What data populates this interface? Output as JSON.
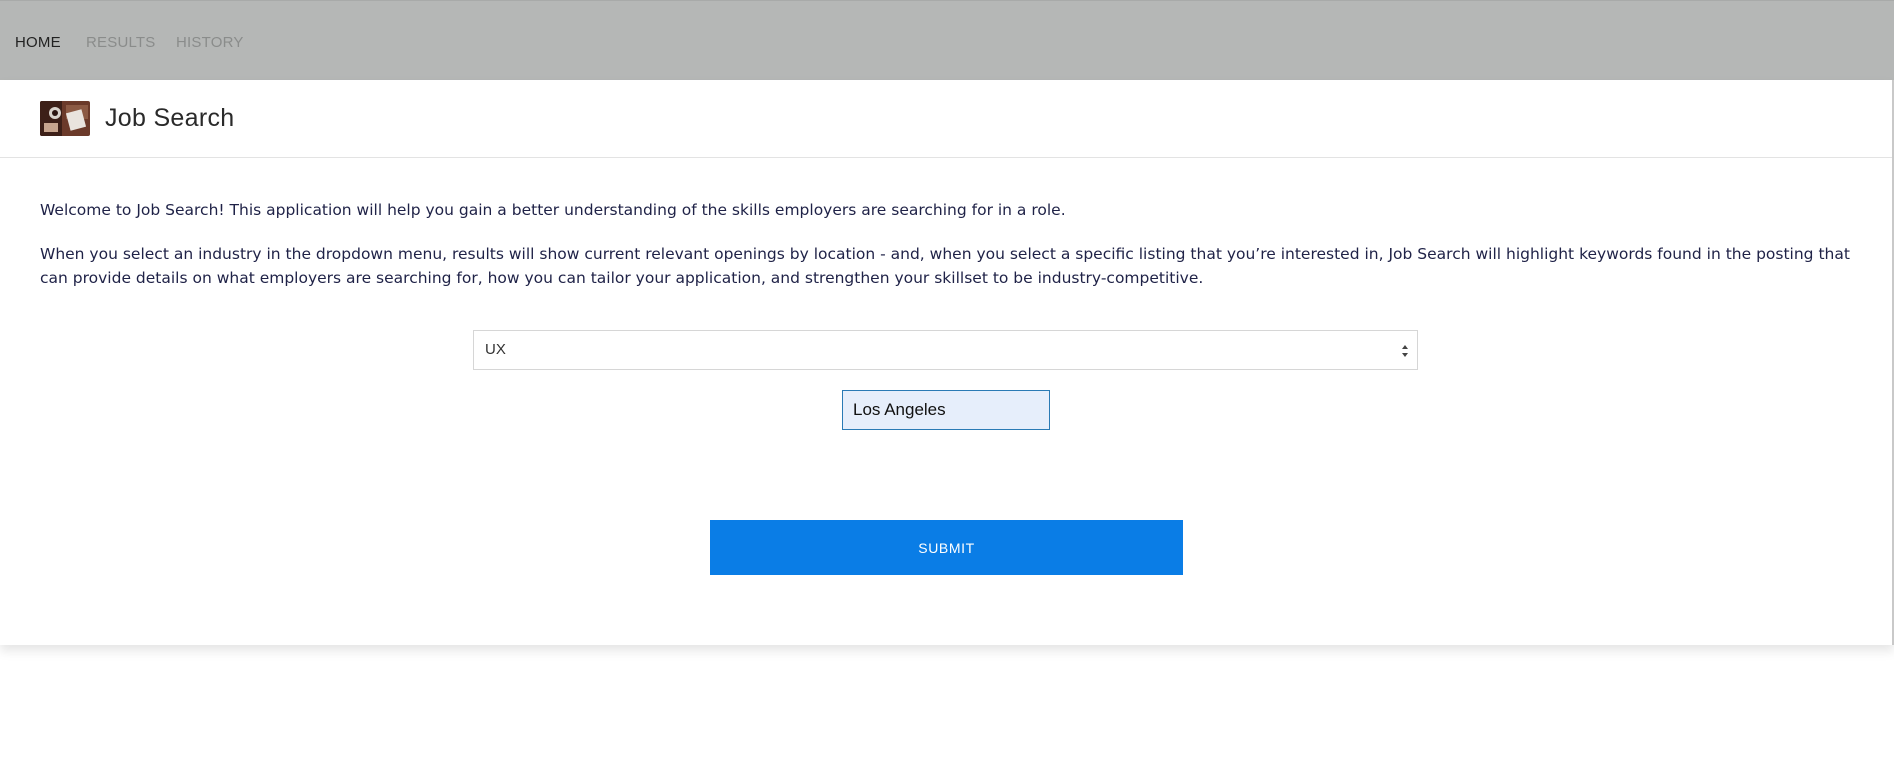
{
  "nav": {
    "items": [
      {
        "label": "HOME",
        "active": true
      },
      {
        "label": "RESULTS",
        "active": false
      },
      {
        "label": "HISTORY",
        "active": false
      }
    ]
  },
  "header": {
    "title": "Job Search",
    "logo_icon": "job-search-logo-photo"
  },
  "main": {
    "intro_1": "Welcome to Job Search! This application will help you gain a better understanding of the skills employers are searching for in a role.",
    "intro_2": "When you select an industry in the dropdown menu, results will show current relevant openings by location - and, when you select a specific listing that you’re interested in, Job Search will highlight keywords found in the posting that can provide details on what employers are searching for, how you can tailor your application, and strengthen your skillset to be industry-competitive.",
    "industry_select": {
      "selected": "UX"
    },
    "location_input": {
      "value": "Los Angeles"
    },
    "submit_label": "SUBMIT"
  },
  "colors": {
    "nav_bg": "#b5b7b6",
    "accent": "#0a7de6",
    "text": "#1f2247"
  }
}
